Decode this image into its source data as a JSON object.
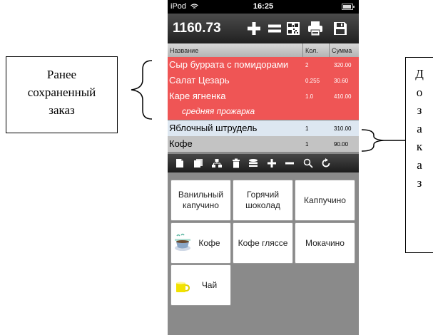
{
  "annotations": {
    "left_callout": "Ранее сохраненный заказ",
    "left_callout_lines": [
      "Ранее",
      "сохраненный",
      "заказ"
    ],
    "right_callout_letters": [
      "Д",
      "о",
      "з",
      "а",
      "к",
      "а",
      "з"
    ]
  },
  "status_bar": {
    "carrier": "iPod",
    "time": "16:25"
  },
  "toolbar": {
    "total": "1160.73",
    "icons": [
      "plus-icon",
      "equals-icon",
      "qr-code-icon",
      "printer-icon",
      "save-icon"
    ]
  },
  "table": {
    "headers": {
      "name": "Название",
      "qty": "Кол.",
      "sum": "Сумма"
    },
    "rows": [
      {
        "name": "Сыр буррата с помидорами",
        "qty": "2",
        "sum": "320.00",
        "state": "saved"
      },
      {
        "name": "Салат Цезарь",
        "qty": "0.255",
        "sum": "30.60",
        "state": "saved"
      },
      {
        "name": "Каре ягненка",
        "qty": "1.0",
        "sum": "410.00",
        "state": "saved"
      },
      {
        "name": "средняя прожарка",
        "qty": "",
        "sum": "",
        "state": "saved-note"
      },
      {
        "name": "Яблочный штрудель",
        "qty": "1",
        "sum": "310.00",
        "state": "new"
      },
      {
        "name": "Кофе",
        "qty": "1",
        "sum": "90.00",
        "state": "new"
      }
    ]
  },
  "action_bar": {
    "icons": [
      "document-icon",
      "copy-icon",
      "split-icon",
      "trash-icon",
      "stack-icon",
      "plus-icon",
      "minus-icon",
      "search-icon",
      "refresh-icon"
    ]
  },
  "products": [
    {
      "label": "Ванильный капучино",
      "icon": ""
    },
    {
      "label": "Горячий шоколад",
      "icon": ""
    },
    {
      "label": "Каппучино",
      "icon": ""
    },
    {
      "label": "Кофе",
      "icon": "coffee-cup-icon"
    },
    {
      "label": "Кофе гляссе",
      "icon": ""
    },
    {
      "label": "Мокачино",
      "icon": ""
    },
    {
      "label": "Чай",
      "icon": "tea-cup-icon"
    }
  ],
  "colors": {
    "saved_row": "#ef5555",
    "new_row_light": "#dde7f1",
    "new_row_gray": "#c3c3c3",
    "bar_dark": "#202020"
  }
}
